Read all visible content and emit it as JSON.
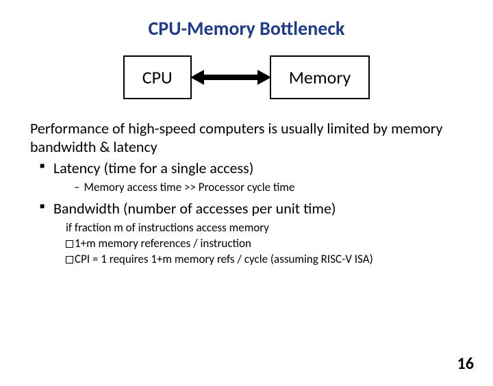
{
  "title": "CPU-Memory Bottleneck",
  "diagram": {
    "left_box": "CPU",
    "right_box": "Memory"
  },
  "intro": "Performance of high-speed computers is usually limited by memory bandwidth & latency",
  "bullets": [
    {
      "text": "Latency (time for a single access)",
      "sub_dash": "Memory access time >> Processor cycle time"
    },
    {
      "text": "Bandwidth (number of accesses per unit time)",
      "sub_lines": [
        "if fraction m of instructions access memory",
        "1+m memory references / instruction",
        "CPI = 1 requires 1+m memory refs / cycle (assuming RISC-V ISA)"
      ]
    }
  ],
  "page_number": "16"
}
